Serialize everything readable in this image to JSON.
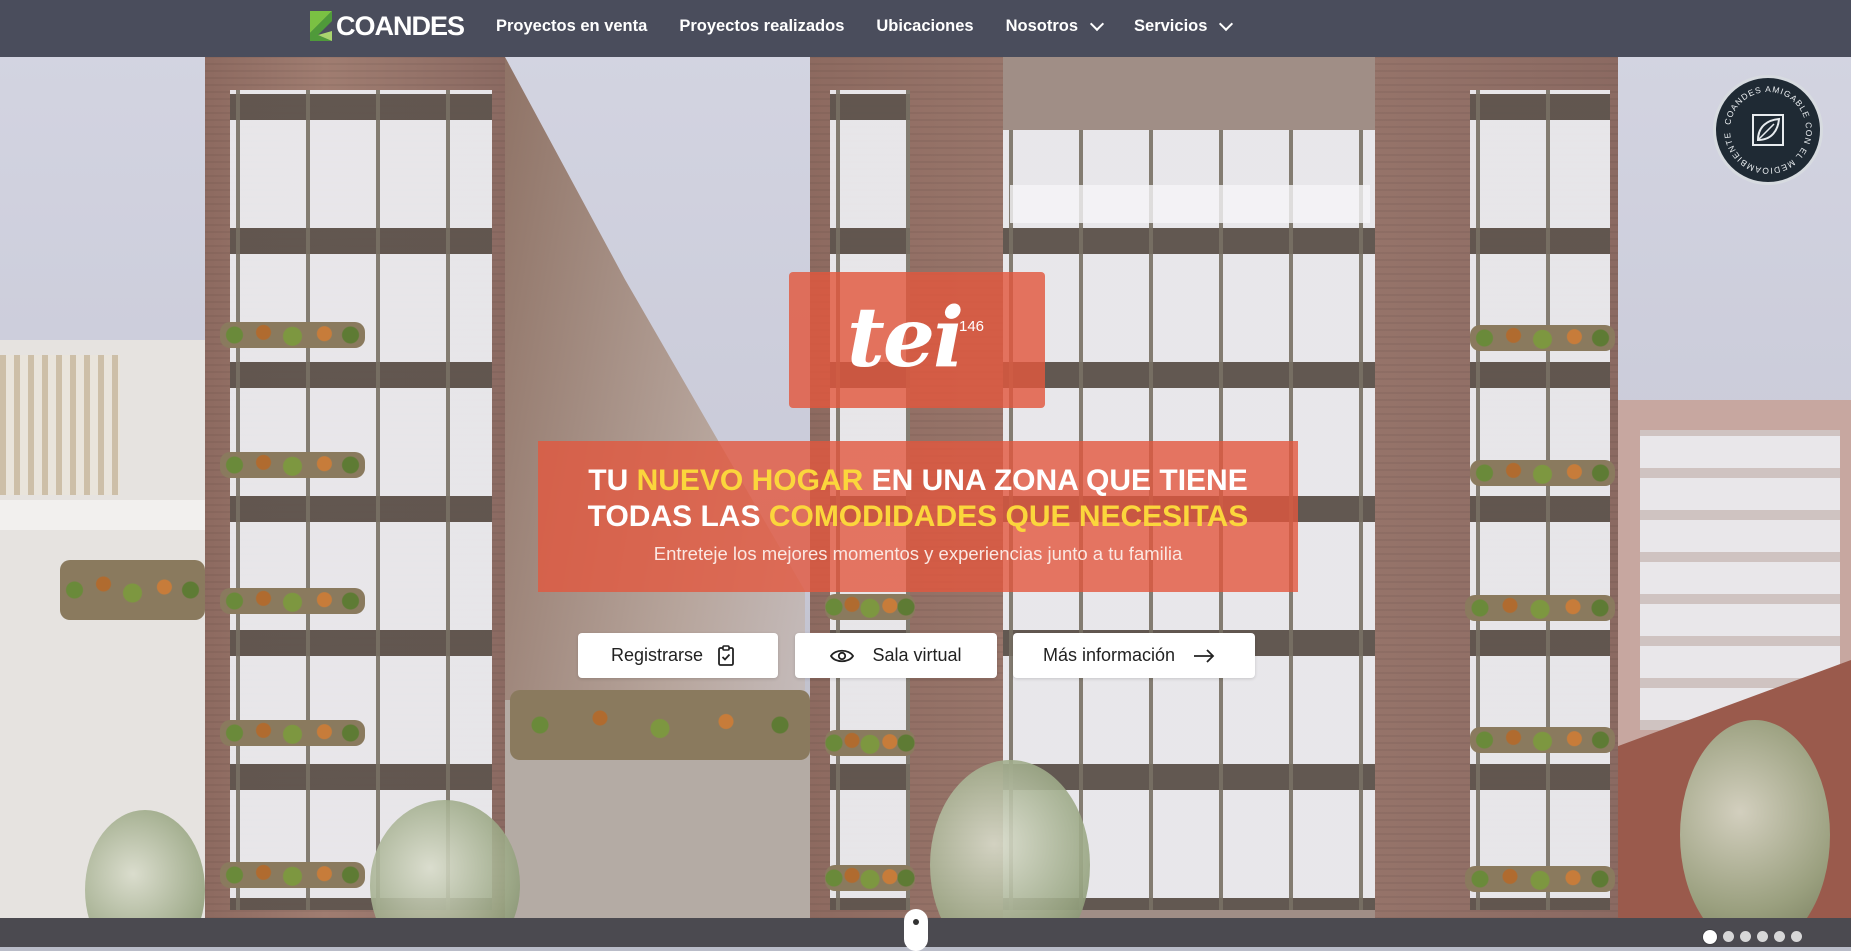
{
  "brand": {
    "name": "COANDES"
  },
  "nav": {
    "items": [
      {
        "label": "Proyectos en venta",
        "dropdown": false
      },
      {
        "label": "Proyectos realizados",
        "dropdown": false
      },
      {
        "label": "Ubicaciones",
        "dropdown": false
      },
      {
        "label": "Nosotros",
        "dropdown": true
      },
      {
        "label": "Servicios",
        "dropdown": true
      }
    ]
  },
  "badge": {
    "text": "COANDES AMIGABLE CON EL MEDIOAMBIENTE",
    "icon": "leaf-icon"
  },
  "project": {
    "name": "tei",
    "number": "146"
  },
  "hero": {
    "headline_line1_a": "TU ",
    "headline_line1_b": "NUEVO HOGAR",
    "headline_line1_c": " EN UNA ZONA QUE TIENE",
    "headline_line2_a": "TODAS LAS ",
    "headline_line2_b": "COMODIDADES QUE NECESITAS",
    "subtitle": "Entreteje los mejores momentos y experiencias junto a tu familia"
  },
  "actions": {
    "register": {
      "label": "Registrarse",
      "icon": "clipboard-check-icon"
    },
    "virtual_room": {
      "label": "Sala virtual",
      "icon": "eye-icon"
    },
    "more_info": {
      "label": "Más información",
      "icon": "arrow-right-icon"
    }
  },
  "carousel": {
    "slides": 6,
    "active": 1
  },
  "colors": {
    "nav_bg": "#3f4352",
    "accent": "#e2583e",
    "highlight": "#fbd63c",
    "logo_green": "#7ac143"
  }
}
